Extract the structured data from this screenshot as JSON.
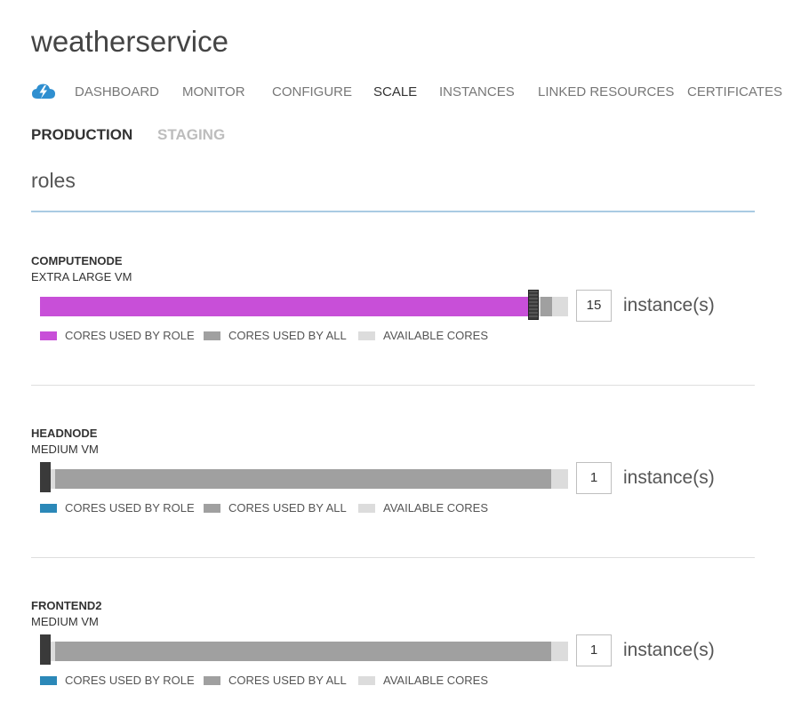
{
  "app": {
    "title": "weatherservice"
  },
  "nav": {
    "icon": "cloud-service-icon",
    "items": [
      {
        "label": "DASHBOARD",
        "active": false
      },
      {
        "label": "MONITOR",
        "active": false
      },
      {
        "label": "CONFIGURE",
        "active": false
      },
      {
        "label": "SCALE",
        "active": true
      },
      {
        "label": "INSTANCES",
        "active": false
      },
      {
        "label": "LINKED RESOURCES",
        "active": false
      },
      {
        "label": "CERTIFICATES",
        "active": false
      }
    ]
  },
  "environment_tabs": [
    {
      "label": "PRODUCTION",
      "active": true
    },
    {
      "label": "STAGING",
      "active": false
    }
  ],
  "section": {
    "title": "roles"
  },
  "colors": {
    "accent_rule": "#a9cbe3",
    "cores_role_compute": "#c84fd8",
    "cores_role_default": "#2b88b8",
    "cores_all": "#a0a0a0",
    "available": "#dcdcdc",
    "handle": "#3a3a3a"
  },
  "roles": [
    {
      "name": "COMPUTENODE",
      "size": "EXTRA LARGE VM",
      "instances": "15",
      "unit": "instance(s)",
      "role_color": "#c84fd8",
      "role_fraction": 0.925,
      "all_fraction": 0.97,
      "legend": {
        "role": "CORES USED BY ROLE",
        "all": "CORES USED BY ALL",
        "available": "AVAILABLE CORES"
      }
    },
    {
      "name": "HEADNODE",
      "size": "MEDIUM VM",
      "instances": "1",
      "unit": "instance(s)",
      "role_color": "#2b88b8",
      "role_fraction": 0.0,
      "all_fraction": 0.968,
      "legend": {
        "role": "CORES USED BY ROLE",
        "all": "CORES USED BY ALL",
        "available": "AVAILABLE CORES"
      }
    },
    {
      "name": "FRONTEND2",
      "size": "MEDIUM VM",
      "instances": "1",
      "unit": "instance(s)",
      "role_color": "#2b88b8",
      "role_fraction": 0.0,
      "all_fraction": 0.968,
      "legend": {
        "role": "CORES USED BY ROLE",
        "all": "CORES USED BY ALL",
        "available": "AVAILABLE CORES"
      }
    }
  ]
}
